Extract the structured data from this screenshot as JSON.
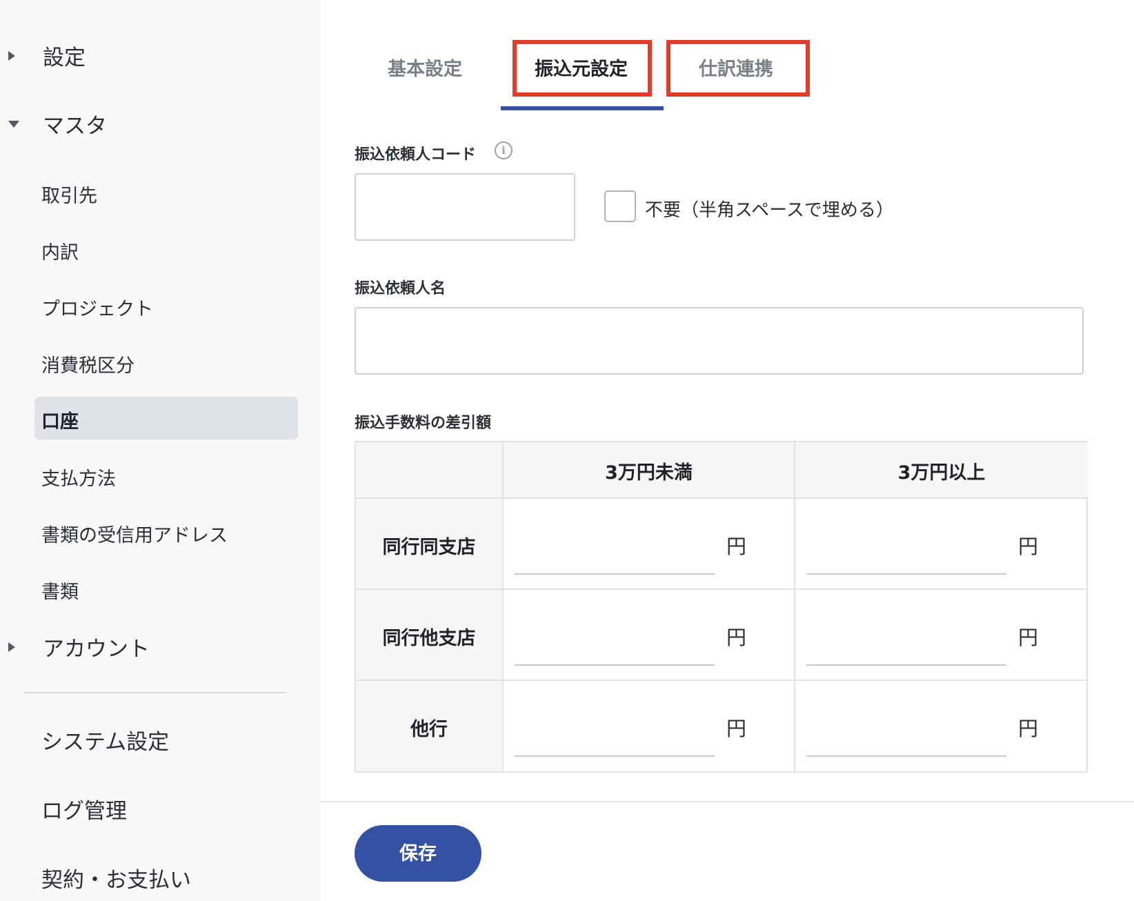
{
  "sidebar": {
    "settings_group": "設定",
    "master_group": "マスタ",
    "master_items": [
      "取引先",
      "内訳",
      "プロジェクト",
      "消費税区分",
      "口座",
      "支払方法",
      "書類の受信用アドレス",
      "書類"
    ],
    "active_item": "口座",
    "account_group": "アカウント",
    "bottom_items": [
      "システム設定",
      "ログ管理",
      "契約・お支払い"
    ]
  },
  "tabs": [
    {
      "label": "基本設定",
      "active": false
    },
    {
      "label": "振込元設定",
      "active": true
    },
    {
      "label": "仕訳連携",
      "active": false
    }
  ],
  "form": {
    "requester_code_label": "振込依頼人コード",
    "requester_code_value": "",
    "not_required_label": "不要（半角スペースで埋める）",
    "not_required_checked": false,
    "requester_name_label": "振込依頼人名",
    "requester_name_value": "",
    "fee_label": "振込手数料の差引額"
  },
  "fee_table": {
    "columns": [
      "3万円未満",
      "3万円以上"
    ],
    "rows": [
      "同行同支店",
      "同行他支店",
      "他行"
    ],
    "unit": "円"
  },
  "save_label": "保存",
  "colors": {
    "accent": "#3451a3",
    "highlight": "#e5392a"
  }
}
